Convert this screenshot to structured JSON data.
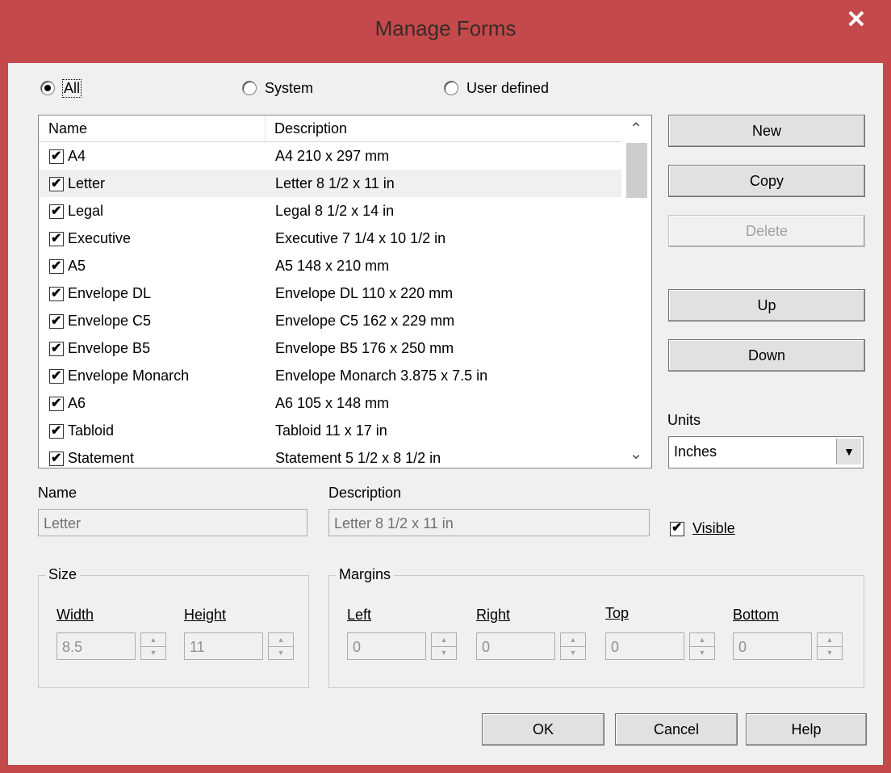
{
  "window": {
    "title": "Manage Forms",
    "close_glyph": "✕",
    "title_bar_color": "#c4494a"
  },
  "filter": {
    "all": "All",
    "system": "System",
    "user_defined": "User defined",
    "selected": "All"
  },
  "list": {
    "columns": [
      "Name",
      "Description"
    ],
    "rows": [
      {
        "name": "A4",
        "description": "A4 210 x 297 mm",
        "checked": true
      },
      {
        "name": "Letter",
        "description": "Letter 8 1/2 x 11 in",
        "checked": true
      },
      {
        "name": "Legal",
        "description": "Legal 8 1/2 x 14 in",
        "checked": true
      },
      {
        "name": "Executive",
        "description": "Executive 7 1/4 x 10 1/2 in",
        "checked": true
      },
      {
        "name": "A5",
        "description": "A5 148 x 210 mm",
        "checked": true
      },
      {
        "name": "Envelope DL",
        "description": "Envelope DL 110 x 220 mm",
        "checked": true
      },
      {
        "name": "Envelope C5",
        "description": "Envelope C5 162 x 229 mm",
        "checked": true
      },
      {
        "name": "Envelope B5",
        "description": "Envelope B5  176 x 250 mm",
        "checked": true
      },
      {
        "name": "Envelope Monarch",
        "description": "Envelope Monarch 3.875 x 7.5 in",
        "checked": true
      },
      {
        "name": "A6",
        "description": "A6 105 x 148 mm",
        "checked": true
      },
      {
        "name": "Tabloid",
        "description": "Tabloid 11 x 17 in",
        "checked": true
      },
      {
        "name": "Statement",
        "description": "Statement 5 1/2 x 8 1/2 in",
        "checked": true
      }
    ],
    "selected_row": "Letter"
  },
  "buttons": {
    "new": "New",
    "copy": "Copy",
    "delete": "Delete",
    "up": "Up",
    "down": "Down",
    "ok": "OK",
    "cancel": "Cancel",
    "help": "Help"
  },
  "units": {
    "label": "Units",
    "value": "Inches"
  },
  "form": {
    "name_label": "Name",
    "name_value": "Letter",
    "description_label": "Description",
    "description_value": "Letter 8 1/2 x 11 in",
    "visible_label": "Visible",
    "visible_checked": true
  },
  "size": {
    "title": "Size",
    "width_label": "Width",
    "width_value": "8.5",
    "height_label": "Height",
    "height_value": "11"
  },
  "margins": {
    "title": "Margins",
    "left_label": "Left",
    "left_value": "0",
    "right_label": "Right",
    "right_value": "0",
    "top_label": "Top",
    "top_value": "0",
    "bottom_label": "Bottom",
    "bottom_value": "0"
  }
}
